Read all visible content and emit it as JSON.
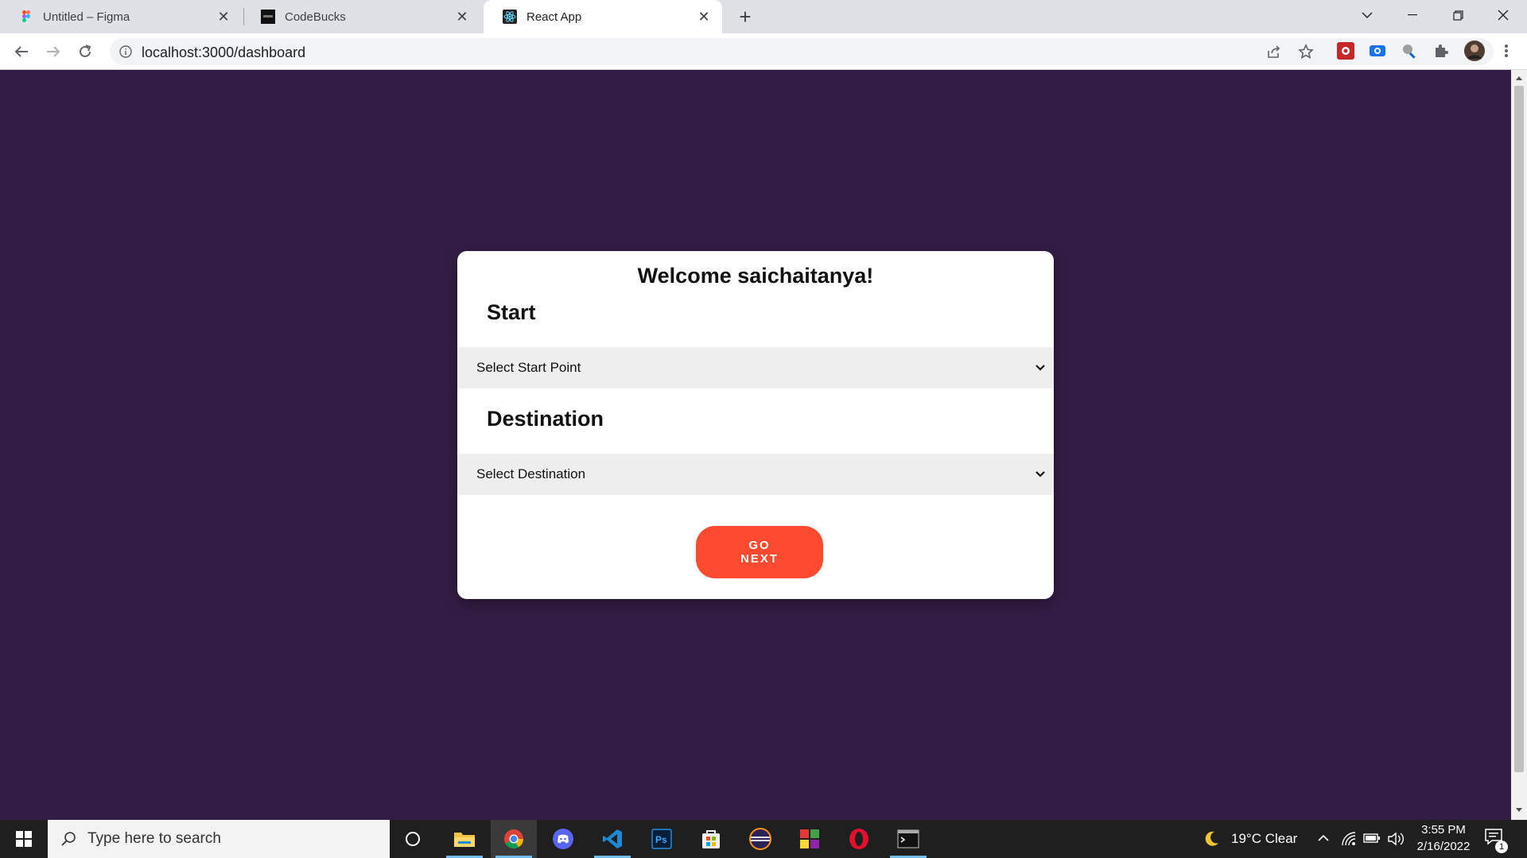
{
  "browser": {
    "tabs": [
      {
        "title": "Untitled – Figma",
        "icon": "figma-icon"
      },
      {
        "title": "CodeBucks",
        "icon": "codebucks-icon"
      },
      {
        "title": "React App",
        "icon": "react-icon",
        "active": true
      }
    ],
    "url": "localhost:3000/dashboard"
  },
  "dashboard": {
    "welcome": "Welcome saichaitanya!",
    "start_label": "Start",
    "start_select": "Select Start Point",
    "destination_label": "Destination",
    "destination_select": "Select Destination",
    "go_next_line1": "GO",
    "go_next_line2": "NEXT",
    "colors": {
      "background": "#341d45",
      "button": "#fe4b2f",
      "card": "#ffffff"
    }
  },
  "taskbar": {
    "search_placeholder": "Type here to search",
    "weather": "19°C  Clear",
    "time": "3:55 PM",
    "date": "2/16/2022",
    "notification_count": "1"
  }
}
